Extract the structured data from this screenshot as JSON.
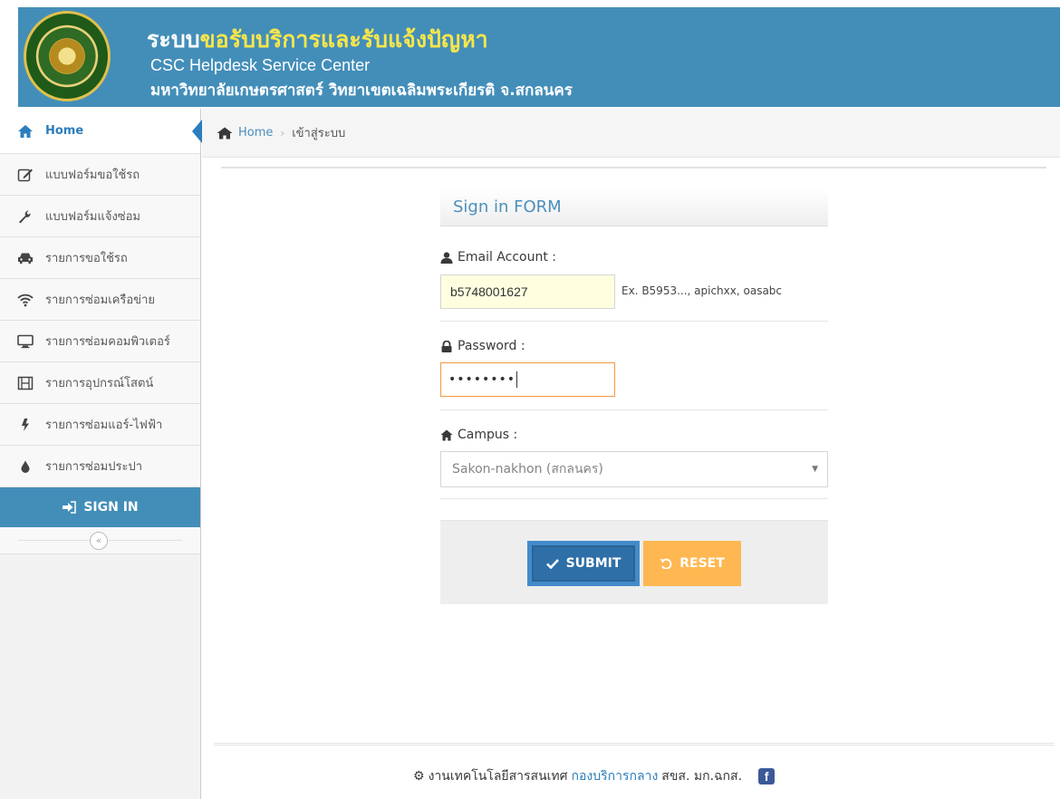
{
  "header": {
    "title_prefix": "ระบบ",
    "title_highlight": "ขอรับบริการและรับแจ้งปัญหา",
    "title_en": "CSC Helpdesk Service Center",
    "university": "มหาวิทยาลัยเกษตรศาสตร์ วิทยาเขตเฉลิมพระเกียรติ จ.สกลนคร"
  },
  "sidebar": {
    "items": [
      {
        "label": "Home",
        "icon": "home-icon"
      },
      {
        "label": "แบบฟอร์มขอใช้รถ",
        "icon": "edit-icon"
      },
      {
        "label": "แบบฟอร์มแจ้งซ่อม",
        "icon": "wrench-icon"
      },
      {
        "label": "รายการขอใช้รถ",
        "icon": "car-icon"
      },
      {
        "label": "รายการซ่อมเครือข่าย",
        "icon": "wifi-icon"
      },
      {
        "label": "รายการซ่อมคอมพิวเตอร์",
        "icon": "desktop-icon"
      },
      {
        "label": "รายการอุปกรณ์โสตน์",
        "icon": "film-icon"
      },
      {
        "label": "รายการซ่อมแอร์-ไฟฟ้า",
        "icon": "bolt-icon"
      },
      {
        "label": "รายการซ่อมประปา",
        "icon": "tint-icon"
      }
    ],
    "sign_in_label": "SIGN IN",
    "collapse_glyph": "«"
  },
  "breadcrumb": {
    "home": "Home",
    "separator": "›",
    "current": "เข้าสู่ระบบ"
  },
  "form": {
    "title": "Sign in FORM",
    "email_label": "Email Account :",
    "email_value": "b5748001627",
    "email_hint": "Ex. B5953..., apichxx, oasabc",
    "password_label": "Password :",
    "password_value": "••••••••",
    "campus_label": "Campus :",
    "campus_selected": "Sakon-nakhon (สกลนคร)",
    "submit_label": "SUBMIT",
    "reset_label": "RESET"
  },
  "footer": {
    "text_before": "งานเทคโนโลยีสารสนเทศ",
    "link": "กองบริการกลาง",
    "text_after": "สขส. มก.ฉกส.",
    "facebook_glyph": "f"
  },
  "colors": {
    "header_bg": "#438eb9",
    "title_highlight": "#f9e64a",
    "accent_blue": "#2b7dbc",
    "submit_bg": "#2f6fa7",
    "reset_bg": "#ffb752",
    "email_field_bg": "#ffffe0",
    "focus_border": "#f59942"
  }
}
